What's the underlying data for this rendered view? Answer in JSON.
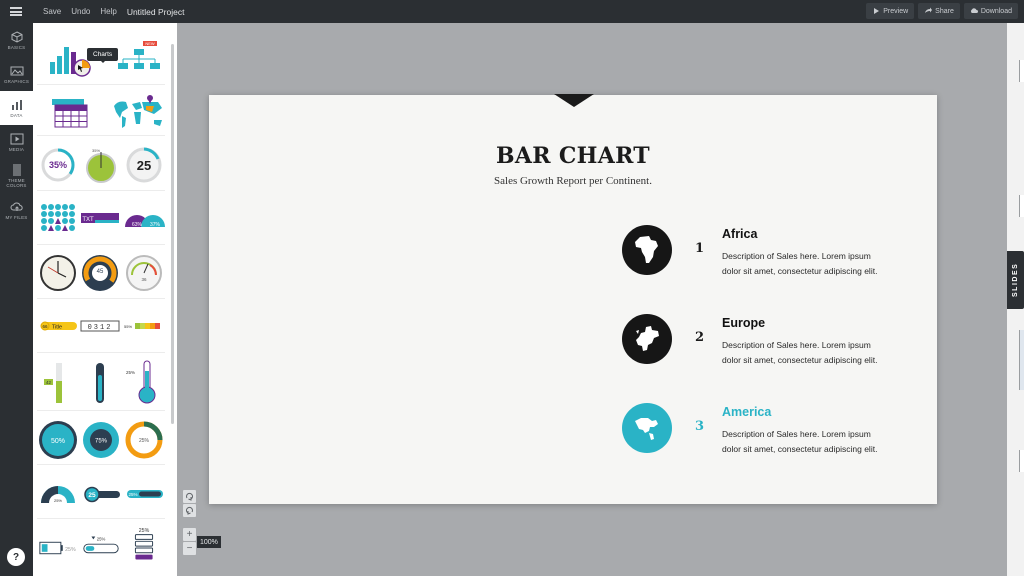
{
  "topbar": {
    "save": "Save",
    "undo": "Undo",
    "help": "Help",
    "project_title": "Untitled Project",
    "preview": "Preview",
    "share": "Share",
    "download": "Download"
  },
  "rail": {
    "items": [
      {
        "label": "BASICS",
        "icon": "cube-icon"
      },
      {
        "label": "GRAPHICS",
        "icon": "picture-icon"
      },
      {
        "label": "DATA",
        "icon": "chart-icon"
      },
      {
        "label": "MEDIA",
        "icon": "play-icon"
      },
      {
        "label": "THEME COLORS",
        "icon": "palette-icon"
      },
      {
        "label": "MY FILES",
        "icon": "cloud-upload-icon"
      }
    ],
    "help": "?"
  },
  "panel": {
    "tooltip": "Charts",
    "new_badge": "NEW",
    "donut_35": "35%",
    "gauge_35": "35%",
    "counter_25": "25",
    "txt_label": "TXT",
    "semi_63": "63%",
    "semi_37": "37%",
    "speed_45": "45",
    "speed_36": "36",
    "title_badge_num": "66",
    "title_badge": "Title",
    "odometer": "0312",
    "bar_55": "55%",
    "thermo_42": "42",
    "thermo_25": "25%",
    "ring_50": "50%",
    "ring_75": "75%",
    "ring_25": "25%",
    "semi_gauge": "25%",
    "pill_25": "25",
    "pill2_25": "25%",
    "battery_25": "25%",
    "progress_25": "25%",
    "stack_25": "25%"
  },
  "slide": {
    "title": "BAR CHART",
    "subtitle": "Sales Growth Report per Continent.",
    "items": [
      {
        "num": "1",
        "name": "Africa",
        "desc": "Description of Sales here. Lorem ipsum dolor sit amet, consectetur adipiscing elit."
      },
      {
        "num": "2",
        "name": "Europe",
        "desc": "Description of Sales here. Lorem ipsum dolor sit amet, consectetur adipiscing elit."
      },
      {
        "num": "3",
        "name": "America",
        "desc": "Description of Sales here. Lorem ipsum dolor sit amet, consectetur adipiscing elit."
      }
    ]
  },
  "canvas": {
    "zoom": "100%"
  },
  "right_panel": {
    "slides_tab": "SLIDES"
  },
  "colors": {
    "accent": "#2ab3c6",
    "dark": "#2b2f33",
    "purple": "#6a2a8f",
    "orange": "#f39c12",
    "green": "#9cc33a"
  }
}
